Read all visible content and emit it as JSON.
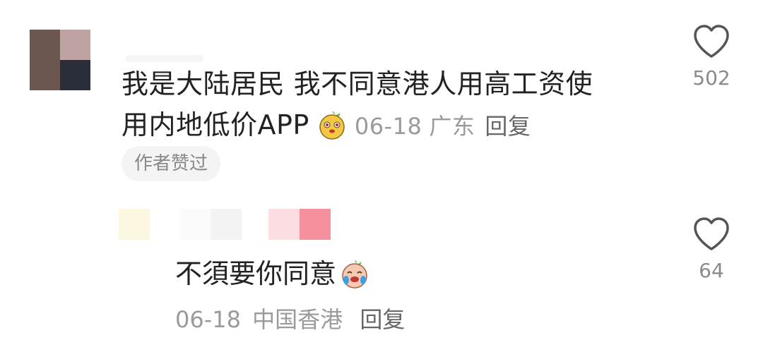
{
  "comment": {
    "text_line1": "我是大陆居民 我不同意港人用高工资使",
    "text_line2": "用内地低价APP",
    "date": "06-18",
    "location": "广东",
    "reply_label": "回复",
    "badge": "作者赞过",
    "likes": "502",
    "emoji": "yellow-mascot-emoji"
  },
  "reply": {
    "text": "不須要你同意",
    "date": "06-18",
    "location": "中国香港",
    "reply_label": "回复",
    "likes": "64",
    "emoji": "crying-mascot-emoji"
  },
  "icons": {
    "like": "heart-outline-icon"
  },
  "colors": {
    "text": "#222222",
    "meta": "#9a9a9a",
    "badge_bg": "#f4f4f4",
    "heart_stroke": "#555555"
  }
}
